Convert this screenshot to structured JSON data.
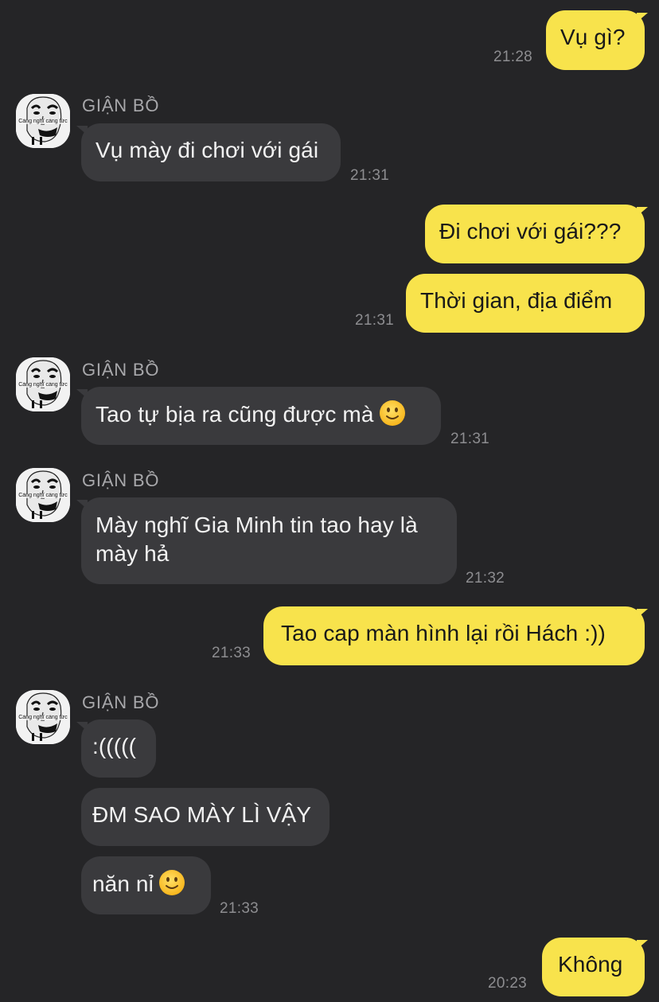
{
  "messages": [
    {
      "text": "Vụ gì?",
      "time": "21:28"
    },
    {
      "sender": "GIẬN BỒ",
      "text": "Vụ mày đi chơi với gái",
      "time": "21:31"
    },
    {
      "text": "Đi chơi với gái???"
    },
    {
      "text": "Thời gian, địa điểm",
      "time": "21:31"
    },
    {
      "sender": "GIẬN BỒ",
      "text": "Tao tự bịa ra cũng được mà",
      "emoji": "slightly-smiling-face-icon",
      "time": "21:31"
    },
    {
      "sender": "GIẬN BỒ",
      "line1": "Mày nghĩ Gia Minh tin tao hay là",
      "line2": "mày hả",
      "time": "21:32"
    },
    {
      "text": "Tao cap màn hình lại rồi Hách :))",
      "time": "21:33"
    },
    {
      "sender": "GIẬN BỒ",
      "text": ":((((("
    },
    {
      "text": "ĐM SAO MÀY LÌ VẬY"
    },
    {
      "text": "năn nỉ",
      "emoji": "slightly-smiling-face-icon",
      "time": "21:33"
    },
    {
      "text": "Không",
      "time": "20:23"
    }
  ],
  "avatar_caption": "Càng nghĩ càng tức",
  "colors": {
    "background": "#252527",
    "outgoing_bubble": "#f8e34c",
    "incoming_bubble": "#3a3a3d",
    "timestamp": "#8d8d90",
    "sender_name": "#a8a8ab"
  }
}
